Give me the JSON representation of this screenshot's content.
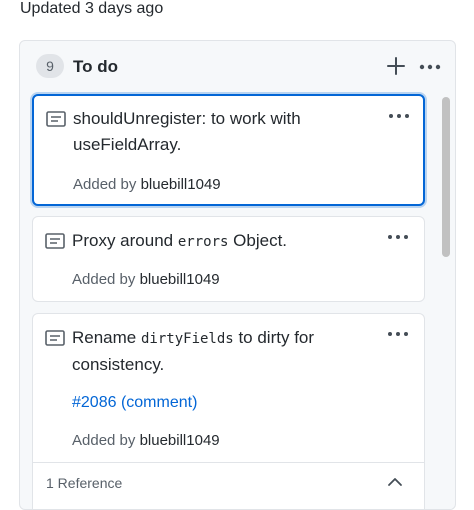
{
  "updated_text": "Updated 3 days ago",
  "column": {
    "count": "9",
    "title": "To do",
    "add_icon": "plus-icon",
    "more_icon": "kebab-horizontal-icon"
  },
  "cards": [
    {
      "icon": "note-icon",
      "title": "shouldUnregister: to work with useFieldArray.",
      "added_by_prefix": "Added by",
      "author": "bluebill1049",
      "selected": true
    },
    {
      "icon": "note-icon",
      "title_before": "Proxy around",
      "title_code": "errors",
      "title_after": "Object.",
      "added_by_prefix": "Added by",
      "author": "bluebill1049"
    },
    {
      "icon": "note-icon",
      "title_before": "Rename",
      "title_code": "dirtyFields",
      "title_after": "to dirty for consistency.",
      "link_text": "#2086 (comment)",
      "added_by_prefix": "Added by",
      "author": "bluebill1049",
      "references_label": "1 Reference",
      "references_icon": "chevron-up-icon"
    }
  ],
  "colors": {
    "accent": "#0366d6",
    "border": "#e1e4e8",
    "column_bg": "#f6f8fa"
  }
}
